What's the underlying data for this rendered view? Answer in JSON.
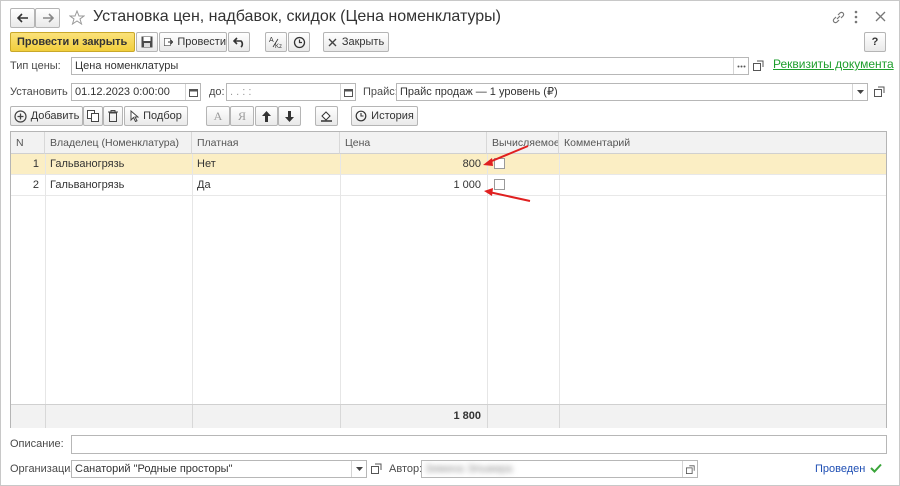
{
  "title": "Установка цен, надбавок, скидок (Цена номенклатуры)",
  "toolbar": {
    "post_close": "Провести и закрыть",
    "post": "Провести",
    "close": "Закрыть",
    "help": "?"
  },
  "form": {
    "price_type_label": "Тип цены:",
    "price_type_value": "Цена номенклатуры",
    "details_link": "Реквизиты документа",
    "set_from_label": "Установить с:",
    "set_from_value": "01.12.2023  0:00:00",
    "to_label": "до:",
    "to_value": ".   .          :   :",
    "pricelist_label": "Прайс:",
    "pricelist_value": "Прайс продаж — 1 уровень (₽)"
  },
  "table_toolbar": {
    "add": "Добавить",
    "pick": "Подбор",
    "history": "История",
    "font_a": "A",
    "font_ya": "Я"
  },
  "table": {
    "columns": [
      "N",
      "Владелец (Номенклатура)",
      "Платная",
      "Цена",
      "Вычисляемое",
      "Комментарий"
    ],
    "rows": [
      {
        "n": "1",
        "owner": "Гальваногрязь",
        "paid": "Нет",
        "price": "800",
        "calc": false,
        "comment": ""
      },
      {
        "n": "2",
        "owner": "Гальваногрязь",
        "paid": "Да",
        "price": "1 000",
        "calc": false,
        "comment": ""
      }
    ],
    "total_price": "1 800"
  },
  "bottom": {
    "description_label": "Описание:",
    "description_value": "",
    "org_label": "Организация:",
    "org_value": "Санаторий \"Родные просторы\"",
    "author_label": "Автор:",
    "author_value": "Зимина Эльмира",
    "status": "Проведен"
  },
  "colors": {
    "accent_yellow": "#f7d749",
    "selected_row": "#fbeec4",
    "link_green": "#1e9e2c",
    "status_blue": "#1f4fb4",
    "annotation_red": "#e02020"
  }
}
